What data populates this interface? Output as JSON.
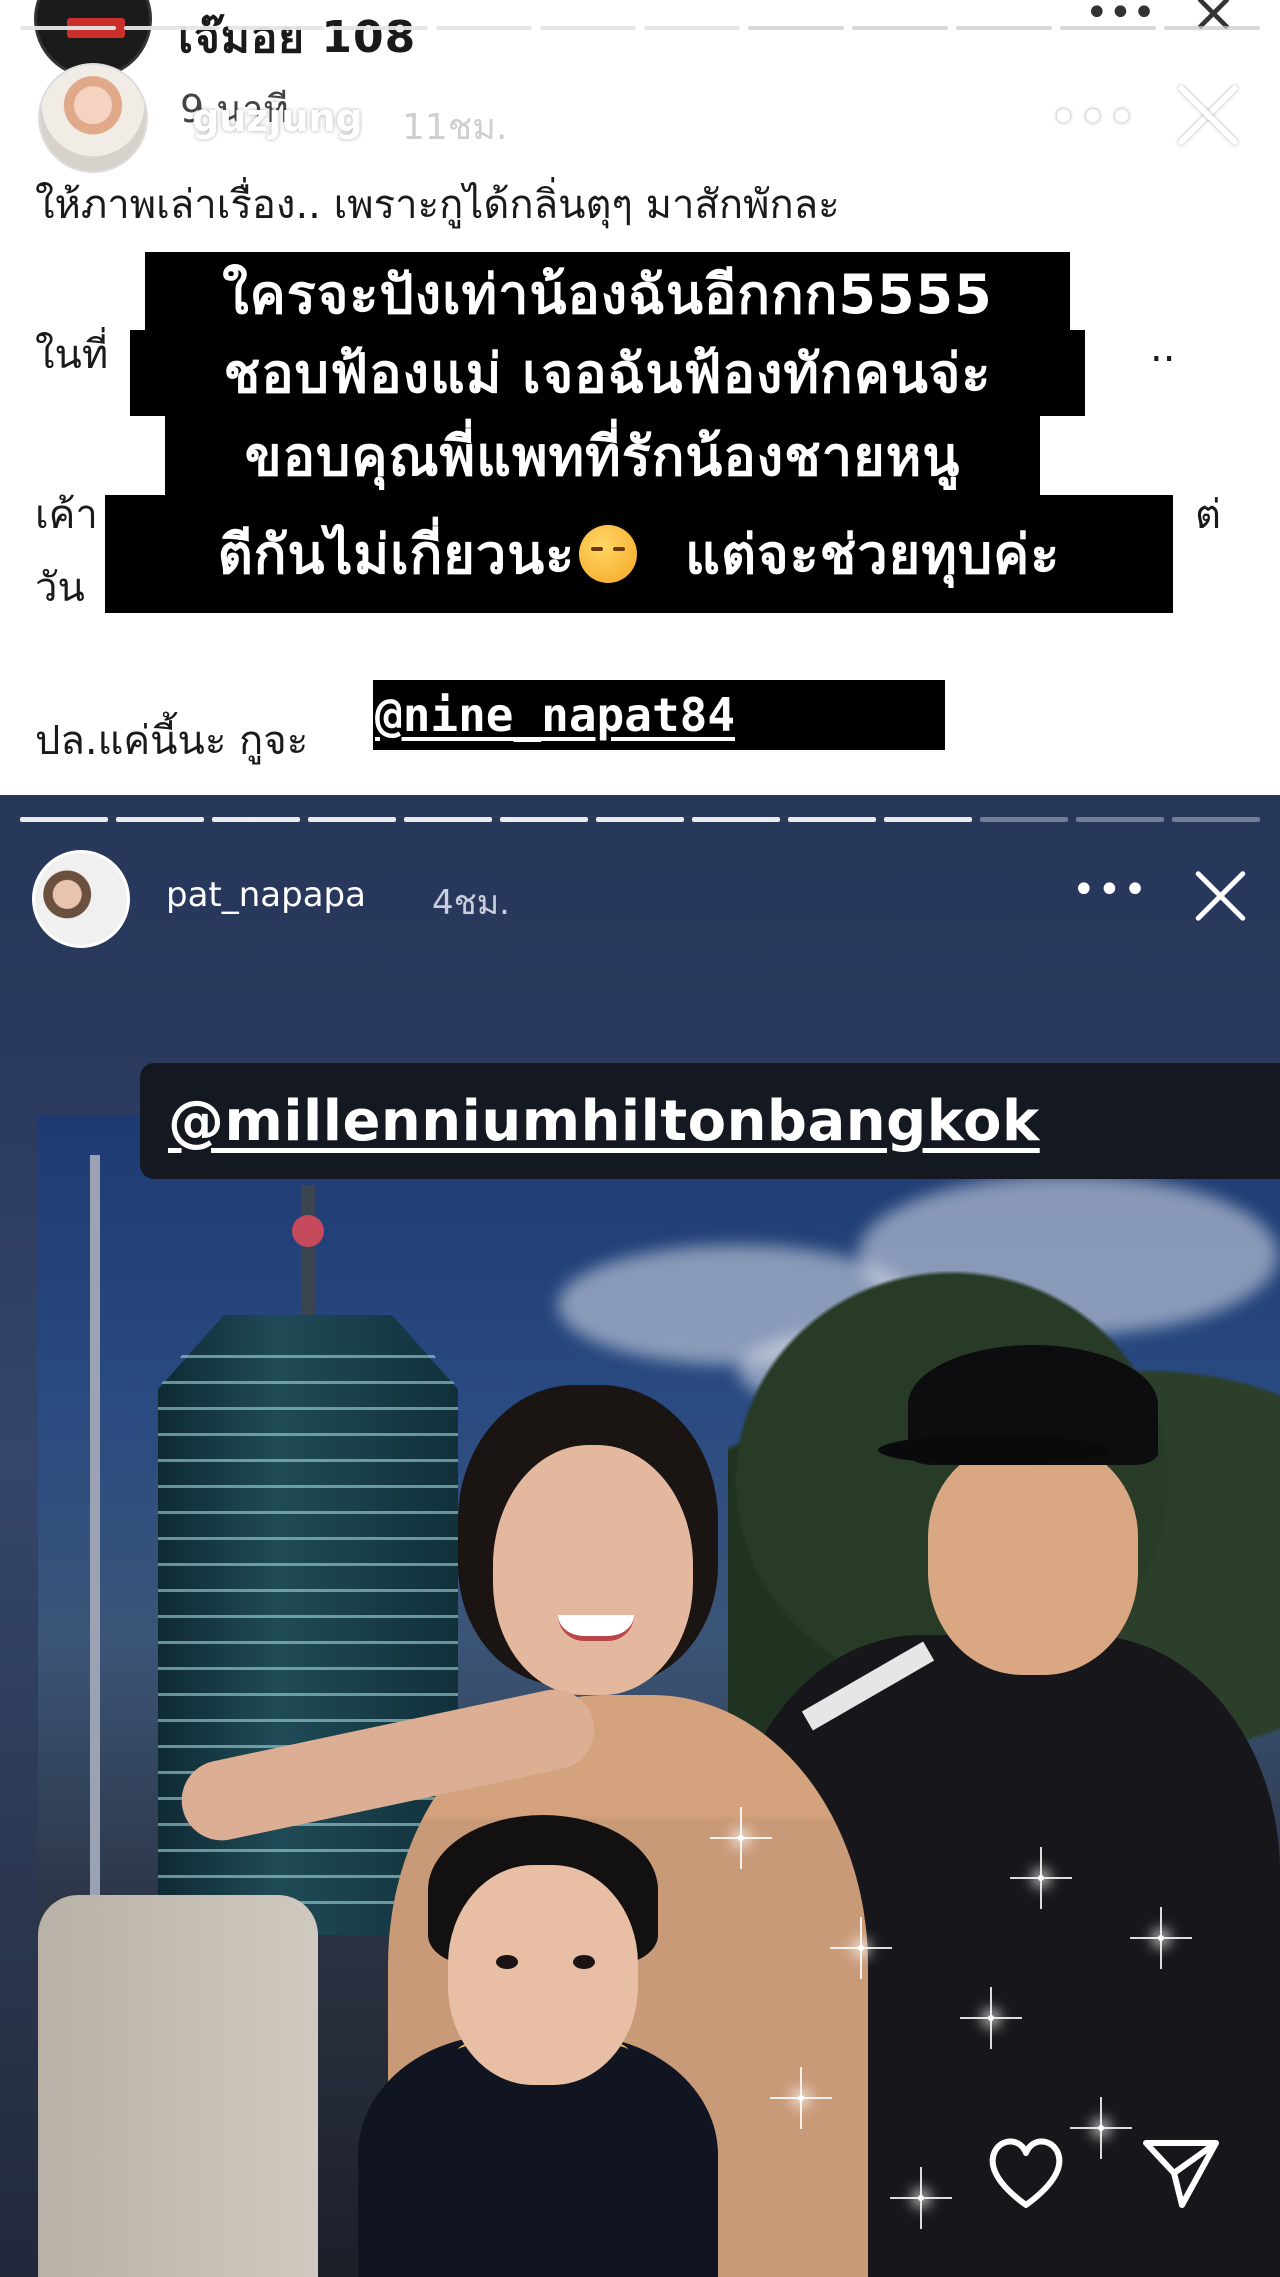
{
  "top_story": {
    "background_post": {
      "username": "เจ๊มอย 108",
      "time": "9 นาที"
    },
    "story_user": {
      "username": "guzjung",
      "time": "11ชม."
    },
    "post_lines": [
      "ให้ภาพเล่าเรื่อง.. เพราะกูได้กลิ่นตุๆ มาสักพักละ",
      "ในที่",
      "เค้า",
      "วัน",
      "ปล.แค่นี้นะ กูจะ"
    ],
    "post_line_fragments": {
      "right_ellipsis": "..",
      "right_fragment": "ต่"
    },
    "caption_lines": [
      "ใครจะปังเท่าน้องฉันอีกกก5555",
      "ชอบฟ้องแม่  เจอฉันฟ้องทักคนจ่ะ",
      "ขอบคุณพี่แพทที่รักน้องชายหนู",
      "ตีกันไม่เกี่ยวนะ",
      "แต่จะช่วยทุบค่ะ"
    ],
    "caption_emoji": "unamused-face",
    "mention": "@nine_napat84"
  },
  "bottom_story": {
    "username": "pat_napapa",
    "time": "4ชม.",
    "location_sticker": "@millenniumhiltonbangkok",
    "actions": {
      "like_icon": "heart-icon",
      "share_icon": "send-icon"
    }
  },
  "colors": {
    "caption_bg": "#000000",
    "caption_text": "#ffffff",
    "bottom_bg": "#2b3b5f"
  }
}
